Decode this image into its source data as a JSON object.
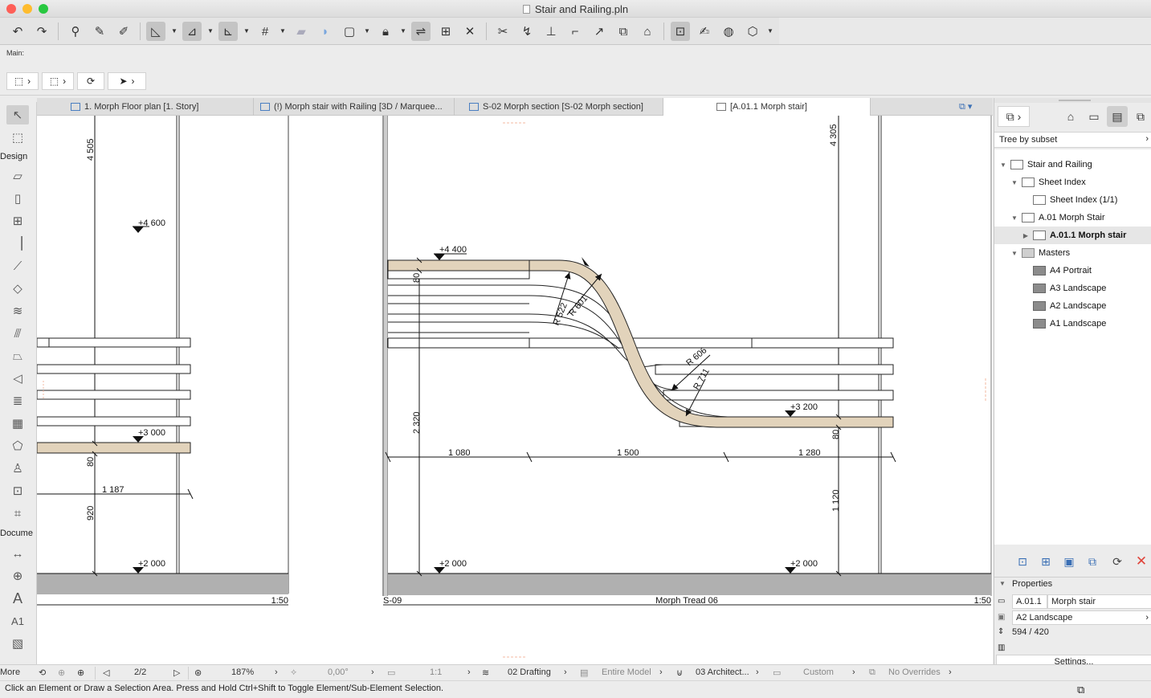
{
  "window": {
    "title": "Stair and Railing.pln",
    "traffic_colors": [
      "#fe5f57",
      "#febc2e",
      "#28c840"
    ]
  },
  "toolbar": {
    "icons": [
      "undo-icon",
      "redo-icon",
      "find-select-icon",
      "eyedropper-icon",
      "syringe-icon",
      "guideline-icon",
      "snap-guides-icon",
      "snap-points-icon",
      "grid-snap-icon",
      "layer-icon",
      "marquee-option-icon",
      "fill-icon",
      "lock-icon",
      "trace-icon",
      "renovation-icon",
      "fit-icon",
      "zoom-fit-icon",
      "split-icon",
      "adjust-icon",
      "elevation-icon",
      "offset-icon",
      "curve-icon",
      "resize-icon",
      "roof-icon",
      "group-icon",
      "edit-icon",
      "solid-icon",
      "3d-view-icon"
    ]
  },
  "infobox": {
    "main_label": "Main:"
  },
  "toolbox": {
    "section_design": "Design",
    "section_document": "Docume",
    "more_label": "More",
    "text_tool": "A",
    "label_tool": "A1"
  },
  "tabs": [
    {
      "label": "1. Morph Floor plan [1. Story]"
    },
    {
      "label": "(!) Morph stair with Railing [3D / Marquee..."
    },
    {
      "label": "S-02 Morph section [S-02 Morph section]"
    },
    {
      "label": "[A.01.1 Morph stair]"
    }
  ],
  "drawing": {
    "left": {
      "dim_4505": "4 505",
      "level_4600": "+4 600",
      "level_3000": "+3 000",
      "level_2000": "+2 000",
      "dim_80": "80",
      "dim_1187": "1 187",
      "dim_920": "920",
      "scale": "1:50"
    },
    "right": {
      "dim_4305": "4 305",
      "level_4400": "+4 400",
      "level_3200": "+3 200",
      "level_2000a": "+2 000",
      "level_2000b": "+2 000",
      "dim_80a": "80",
      "dim_80b": "80",
      "dim_2320": "2 320",
      "dim_1080": "1 080",
      "dim_1500": "1 500",
      "dim_1280": "1 280",
      "dim_1120": "1 120",
      "r522": "R 522",
      "r601": "R 601",
      "r606": "R 606",
      "r711": "R 711",
      "section_id": "S-09",
      "title": "Morph Tread 06",
      "scale": "1:50"
    }
  },
  "navigator": {
    "tree_mode": "Tree by subset",
    "items": [
      {
        "label": "Stair and Railing",
        "indent": 0,
        "expanded": true,
        "icon": "book"
      },
      {
        "label": "Sheet Index",
        "indent": 1,
        "expanded": true,
        "icon": "sheet"
      },
      {
        "label": "Sheet Index (1/1)",
        "indent": 2,
        "expanded": null,
        "icon": "sheet"
      },
      {
        "label": "A.01 Morph Stair",
        "indent": 1,
        "expanded": true,
        "icon": "subset"
      },
      {
        "label": "A.01.1 Morph stair",
        "indent": 2,
        "expanded": false,
        "icon": "sheet",
        "selected": true
      },
      {
        "label": "Masters",
        "indent": 1,
        "expanded": true,
        "icon": "folder"
      },
      {
        "label": "A4 Portrait",
        "indent": 2,
        "expanded": null,
        "icon": "master"
      },
      {
        "label": "A3 Landscape",
        "indent": 2,
        "expanded": null,
        "icon": "master"
      },
      {
        "label": "A2 Landscape",
        "indent": 2,
        "expanded": null,
        "icon": "master"
      },
      {
        "label": "A1 Landscape",
        "indent": 2,
        "expanded": null,
        "icon": "master"
      }
    ],
    "properties_label": "Properties",
    "prop_id": "A.01.1",
    "prop_name": "Morph stair",
    "prop_master": "A2 Landscape",
    "prop_size": "594 / 420",
    "settings_label": "Settings..."
  },
  "bottombar": {
    "page": "2/2",
    "zoom": "187%",
    "angle": "0,00°",
    "scale": "1:1",
    "layer_combo": "02 Drafting",
    "model_view": "Entire Model",
    "pen_set": "03 Architect...",
    "dimension": "Custom",
    "overrides": "No Overrides"
  },
  "status": {
    "text": "Click an Element or Draw a Selection Area. Press and Hold Ctrl+Shift to Toggle Element/Sub-Element Selection."
  },
  "colors": {
    "tread": "#e2d3bb",
    "ground": "#b0b0b0",
    "accent": "#3a6fb5",
    "delete": "#e0443a"
  }
}
